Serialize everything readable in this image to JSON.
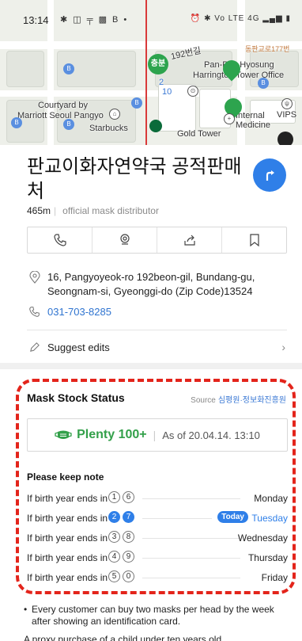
{
  "status_bar": {
    "time": "13:14",
    "left_icons": "✱ ◫ ╤ ▩ B •",
    "right_icons": "⏰ ✱ Vo LTE 4G ▂▄▆ ▮"
  },
  "map": {
    "labels": {
      "station": "충분",
      "road": "192번길",
      "pangyo_hyosung": "Pan-Pyo Hyosung",
      "harrington": "Harrington Tower Office",
      "road_small": "동판교로177번",
      "courtyard": "Courtyard by",
      "marriott": "Marriott Seoul Pangyo",
      "starbucks": "Starbucks",
      "gold_tower": "Gold Tower",
      "internal": "Internal",
      "medicine": "Medicine",
      "vips": "VIPS",
      "pin_num": "2",
      "road_num": "10"
    }
  },
  "place": {
    "name": "판교이화자연약국 공적판매처",
    "distance": "465m",
    "category": "official mask distributor"
  },
  "actions": [
    "call",
    "save-location",
    "share",
    "bookmark"
  ],
  "info": {
    "address": "16, Pangyoyeok-ro 192beon-gil, Bundang-gu, Seongnam-si, Gyeonggi-do (Zip Code)13524",
    "phone": "031-703-8285",
    "suggest_edits": "Suggest edits"
  },
  "mask_stock": {
    "title": "Mask Stock Status",
    "source_label": "Source",
    "source_org": "심평원·정보화진흥원",
    "status": "Plenty 100+",
    "as_of": "As of 20.04.14. 13:10",
    "note_title": "Please keep note",
    "rows": [
      {
        "prefix": "If birth year ends in",
        "digits": [
          "1",
          "6"
        ],
        "day": "Monday",
        "today": false
      },
      {
        "prefix": "If birth year ends in",
        "digits": [
          "2",
          "7"
        ],
        "day": "Tuesday",
        "today": true,
        "badge": "Today"
      },
      {
        "prefix": "If birth year ends in",
        "digits": [
          "3",
          "8"
        ],
        "day": "Wednesday",
        "today": false
      },
      {
        "prefix": "If birth year ends in",
        "digits": [
          "4",
          "9"
        ],
        "day": "Thursday",
        "today": false
      },
      {
        "prefix": "If birth year ends in",
        "digits": [
          "5",
          "0"
        ],
        "day": "Friday",
        "today": false
      }
    ],
    "bullet_note": "Every customer can buy two masks per head by the week after showing an identification card.",
    "bullet_cut": "A proxy purchase of a child under ten years old..."
  },
  "colors": {
    "accent_blue": "#2f7fe8",
    "plenty_green": "#33a04a",
    "highlight_red": "#e3241b"
  }
}
